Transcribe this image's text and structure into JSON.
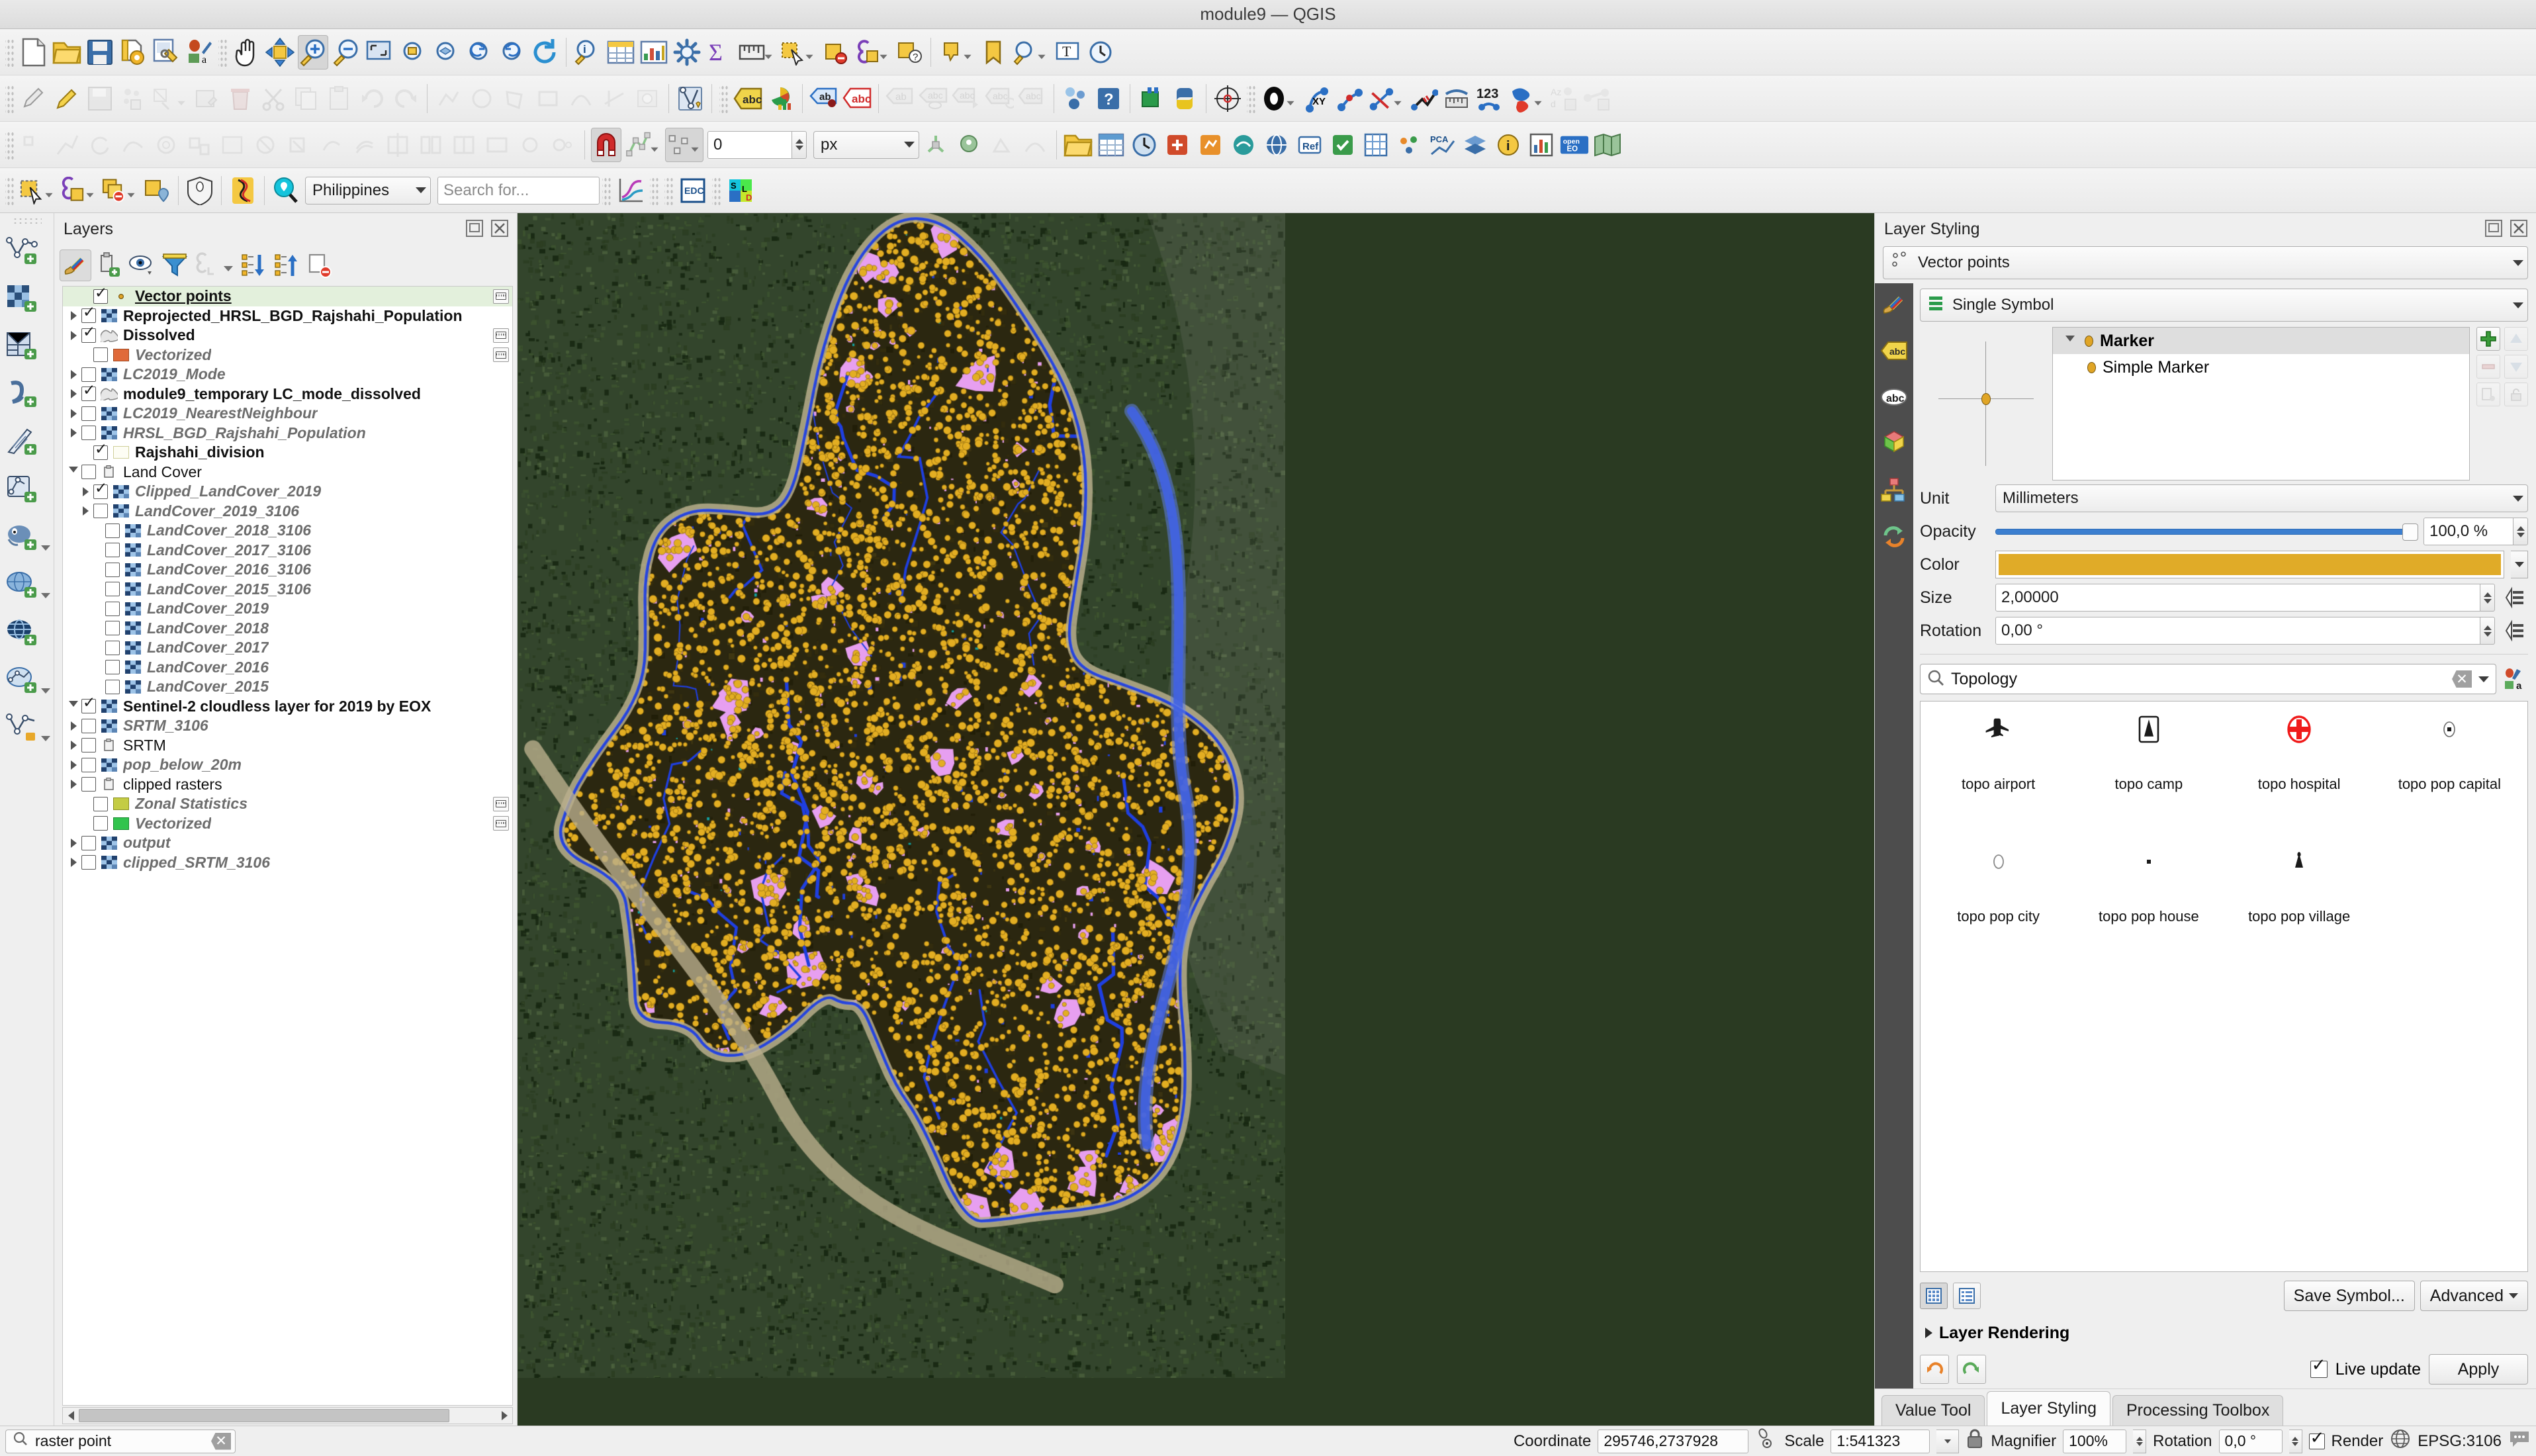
{
  "window": {
    "title": "module9 — QGIS"
  },
  "toolbars": {
    "row3_offset_value": "0",
    "row3_unit": "px",
    "row4_locale": "Philippines",
    "row4_search_placeholder": "Search for...",
    "row4_edc_label": "EDC",
    "row3_number_label": "123"
  },
  "layers_panel": {
    "title": "Layers",
    "toolbar_icons": [
      "style-manager-icon",
      "add-group-icon",
      "manage-visibility-icon",
      "filter-legend-icon",
      "expression-filter-icon",
      "expand-all-icon",
      "collapse-all-icon",
      "remove-layer-icon"
    ],
    "items": [
      {
        "label": "Vector points",
        "checked": true,
        "expand": "none",
        "style": "underline",
        "symbol": "point-dot",
        "edit": true,
        "indent": 1,
        "selected": true
      },
      {
        "label": "Reprojected_HRSL_BGD_Rajshahi_Population",
        "checked": true,
        "expand": "closed",
        "style": "bold",
        "symbol": "raster",
        "edit": false,
        "indent": 0
      },
      {
        "label": "Dissolved",
        "checked": true,
        "expand": "closed",
        "style": "bold",
        "symbol": "polygon-gray",
        "edit": true,
        "indent": 0
      },
      {
        "label": "Vectorized",
        "checked": false,
        "expand": "none",
        "style": "italic",
        "symbol": "swatch-orange",
        "edit": true,
        "indent": 1
      },
      {
        "label": "LC2019_Mode",
        "checked": false,
        "expand": "closed",
        "style": "italic",
        "symbol": "raster",
        "edit": false,
        "indent": 0
      },
      {
        "label": "module9_temporary LC_mode_dissolved",
        "checked": true,
        "expand": "closed",
        "style": "bold",
        "symbol": "polygon-gray",
        "edit": false,
        "indent": 0
      },
      {
        "label": "LC2019_NearestNeighbour",
        "checked": false,
        "expand": "closed",
        "style": "italic",
        "symbol": "raster",
        "edit": false,
        "indent": 0
      },
      {
        "label": "HRSL_BGD_Rajshahi_Population",
        "checked": false,
        "expand": "closed",
        "style": "italic",
        "symbol": "raster",
        "edit": false,
        "indent": 0
      },
      {
        "label": "Rajshahi_division",
        "checked": true,
        "expand": "none",
        "style": "bold",
        "symbol": "swatch-empty",
        "edit": false,
        "indent": 1
      },
      {
        "label": "Land Cover",
        "checked": false,
        "expand": "open",
        "style": "normal",
        "symbol": "group",
        "edit": false,
        "indent": 0
      },
      {
        "label": "Clipped_LandCover_2019",
        "checked": true,
        "expand": "closed",
        "style": "italic",
        "symbol": "raster",
        "edit": false,
        "indent": 1
      },
      {
        "label": "LandCover_2019_3106",
        "checked": false,
        "expand": "closed",
        "style": "italic",
        "symbol": "raster",
        "edit": false,
        "indent": 1
      },
      {
        "label": "LandCover_2018_3106",
        "checked": false,
        "expand": "none",
        "style": "italic",
        "symbol": "raster",
        "edit": false,
        "indent": 2
      },
      {
        "label": "LandCover_2017_3106",
        "checked": false,
        "expand": "none",
        "style": "italic",
        "symbol": "raster",
        "edit": false,
        "indent": 2
      },
      {
        "label": "LandCover_2016_3106",
        "checked": false,
        "expand": "none",
        "style": "italic",
        "symbol": "raster",
        "edit": false,
        "indent": 2
      },
      {
        "label": "LandCover_2015_3106",
        "checked": false,
        "expand": "none",
        "style": "italic",
        "symbol": "raster",
        "edit": false,
        "indent": 2
      },
      {
        "label": "LandCover_2019",
        "checked": false,
        "expand": "none",
        "style": "italic",
        "symbol": "raster",
        "edit": false,
        "indent": 2
      },
      {
        "label": "LandCover_2018",
        "checked": false,
        "expand": "none",
        "style": "italic",
        "symbol": "raster",
        "edit": false,
        "indent": 2
      },
      {
        "label": "LandCover_2017",
        "checked": false,
        "expand": "none",
        "style": "italic",
        "symbol": "raster",
        "edit": false,
        "indent": 2
      },
      {
        "label": "LandCover_2016",
        "checked": false,
        "expand": "none",
        "style": "italic",
        "symbol": "raster",
        "edit": false,
        "indent": 2
      },
      {
        "label": "LandCover_2015",
        "checked": false,
        "expand": "none",
        "style": "italic",
        "symbol": "raster",
        "edit": false,
        "indent": 2
      },
      {
        "label": "Sentinel-2 cloudless layer for 2019 by EOX",
        "checked": true,
        "expand": "open",
        "style": "bold",
        "symbol": "raster",
        "edit": false,
        "indent": 0
      },
      {
        "label": "SRTM_3106",
        "checked": false,
        "expand": "closed",
        "style": "italic",
        "symbol": "raster",
        "edit": false,
        "indent": 0
      },
      {
        "label": "SRTM",
        "checked": false,
        "expand": "closed",
        "style": "normal",
        "symbol": "group",
        "edit": false,
        "indent": 0
      },
      {
        "label": "pop_below_20m",
        "checked": false,
        "expand": "closed",
        "style": "italic",
        "symbol": "raster",
        "edit": false,
        "indent": 0
      },
      {
        "label": "clipped rasters",
        "checked": false,
        "expand": "closed",
        "style": "normal",
        "symbol": "group",
        "edit": false,
        "indent": 0
      },
      {
        "label": "Zonal Statistics",
        "checked": false,
        "expand": "none",
        "style": "italic",
        "symbol": "swatch-olive",
        "edit": true,
        "indent": 1
      },
      {
        "label": "Vectorized",
        "checked": false,
        "expand": "none",
        "style": "italic",
        "symbol": "swatch-green",
        "edit": true,
        "indent": 1
      },
      {
        "label": "output",
        "checked": false,
        "expand": "closed",
        "style": "italic",
        "symbol": "raster",
        "edit": false,
        "indent": 0
      },
      {
        "label": "clipped_SRTM_3106",
        "checked": false,
        "expand": "closed",
        "style": "italic",
        "symbol": "raster",
        "edit": false,
        "indent": 0
      }
    ]
  },
  "style_panel": {
    "title": "Layer Styling",
    "layer_name": "Vector points",
    "renderer": "Single Symbol",
    "symbol_tree": {
      "root": "Marker",
      "child": "Simple Marker"
    },
    "unit_label": "Unit",
    "unit_value": "Millimeters",
    "opacity_label": "Opacity",
    "opacity_value": "100,0 %",
    "color_label": "Color",
    "color_value": "#e0ab28",
    "size_label": "Size",
    "size_value": "2,00000",
    "rotation_label": "Rotation",
    "rotation_value": "0,00 °",
    "symbol_search_value": "Topology",
    "gallery": [
      {
        "label": "topo airport",
        "icon": "airplane-icon"
      },
      {
        "label": "topo camp",
        "icon": "camp-icon"
      },
      {
        "label": "topo hospital",
        "icon": "hospital-cross-icon"
      },
      {
        "label": "topo pop capital",
        "icon": "capital-dot-icon"
      },
      {
        "label": "topo pop city",
        "icon": "city-circle-icon"
      },
      {
        "label": "topo pop house",
        "icon": "house-square-icon"
      },
      {
        "label": "topo pop village",
        "icon": "village-triangle-icon"
      }
    ],
    "save_symbol_label": "Save Symbol...",
    "advanced_label": "Advanced",
    "layer_rendering_label": "Layer Rendering",
    "live_update_label": "Live update",
    "live_update_checked": true,
    "apply_label": "Apply"
  },
  "bottom_tabs": [
    {
      "label": "Value Tool",
      "active": false
    },
    {
      "label": "Layer Styling",
      "active": true
    },
    {
      "label": "Processing Toolbox",
      "active": false
    }
  ],
  "status_bar": {
    "locator_value": "raster point",
    "coordinate_label": "Coordinate",
    "coordinate_value": "295746,2737928",
    "scale_label": "Scale",
    "scale_value": "1:541323",
    "magnifier_label": "Magnifier",
    "magnifier_value": "100%",
    "rotation_label": "Rotation",
    "rotation_value": "0,0 °",
    "render_label": "Render",
    "render_checked": true,
    "crs_label": "EPSG:3106"
  },
  "map": {
    "background_color": "#33452c",
    "point_color": "#e3ae22",
    "builtup_color": "#e79ff0",
    "water_color": "#1f3fe0",
    "sand_color": "#b9ae8c",
    "land_fill": "#2b2710"
  }
}
